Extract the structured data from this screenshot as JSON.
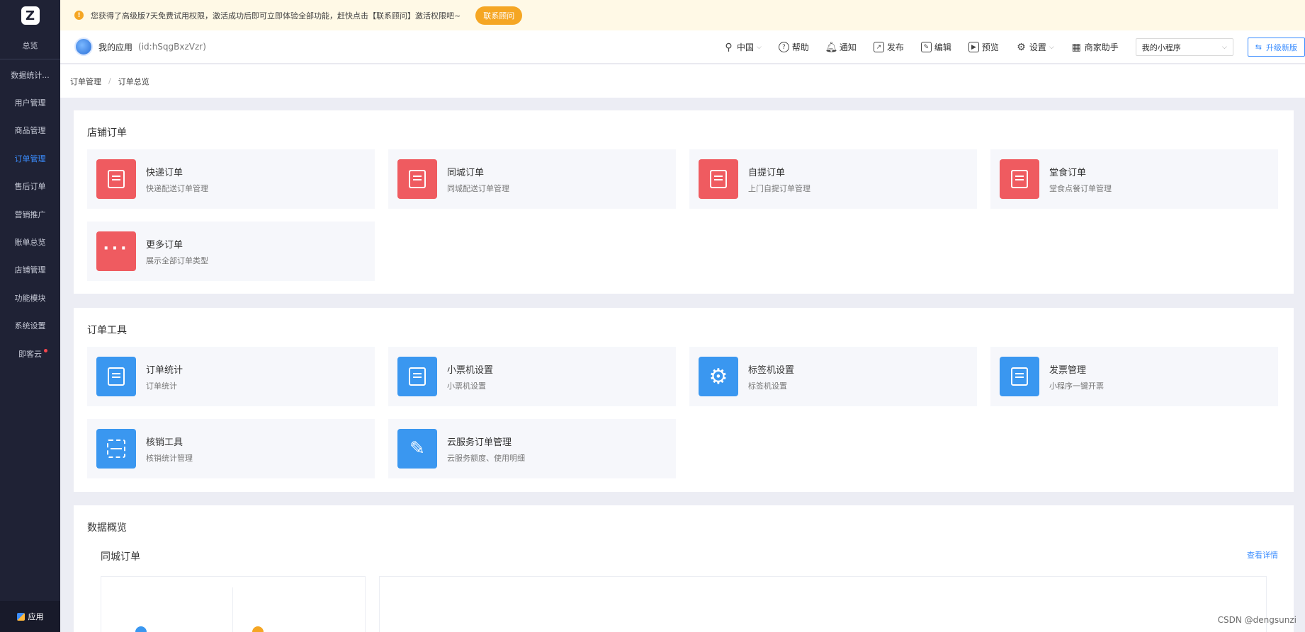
{
  "sidebar": {
    "logo": "Z",
    "items": [
      {
        "label": "总览"
      },
      {
        "label": "数据统计..."
      },
      {
        "label": "用户管理"
      },
      {
        "label": "商品管理"
      },
      {
        "label": "订单管理"
      },
      {
        "label": "售后订单"
      },
      {
        "label": "营销推广"
      },
      {
        "label": "账单总览"
      },
      {
        "label": "店铺管理"
      },
      {
        "label": "功能模块"
      },
      {
        "label": "系统设置"
      },
      {
        "label": "即客云"
      }
    ],
    "active_index": 4,
    "bottom_label": "应用"
  },
  "banner": {
    "text": "您获得了高级版7天免费试用权限，激活成功后即可立即体验全部功能，赶快点击【联系顾问】激活权限吧~",
    "button": "联系顾问"
  },
  "header": {
    "app_name": "我的应用",
    "app_id": "(id:hSqgBxzVzr)",
    "region": "中国",
    "help": "帮助",
    "notify": "通知",
    "publish": "发布",
    "edit": "编辑",
    "preview": "预览",
    "settings": "设置",
    "merchant": "商家助手",
    "select_value": "我的小程序",
    "upgrade": "升级新版"
  },
  "breadcrumb": {
    "items": [
      "订单管理",
      "订单总览"
    ]
  },
  "store_orders": {
    "title": "店铺订单",
    "tiles": [
      {
        "name": "快递订单",
        "desc": "快递配送订单管理"
      },
      {
        "name": "同城订单",
        "desc": "同城配送订单管理"
      },
      {
        "name": "自提订单",
        "desc": "上门自提订单管理"
      },
      {
        "name": "堂食订单",
        "desc": "堂食点餐订单管理"
      },
      {
        "name": "更多订单",
        "desc": "展示全部订单类型"
      }
    ]
  },
  "order_tools": {
    "title": "订单工具",
    "tiles": [
      {
        "name": "订单统计",
        "desc": "订单统计"
      },
      {
        "name": "小票机设置",
        "desc": "小票机设置"
      },
      {
        "name": "标签机设置",
        "desc": "标签机设置"
      },
      {
        "name": "发票管理",
        "desc": "小程序一键开票"
      },
      {
        "name": "核销工具",
        "desc": "核销统计管理"
      },
      {
        "name": "云服务订单管理",
        "desc": "云服务额度、使用明细"
      }
    ]
  },
  "overview": {
    "title": "数据概览",
    "subtitle": "同城订单",
    "detail_link": "查看详情"
  },
  "watermark": "CSDN @dengsunzi",
  "colors": {
    "sidebar_bg": "#1f2235",
    "accent": "#3b8dff",
    "tile_red": "#ef5b60",
    "tile_blue": "#3a97f0",
    "banner_bg": "#fff9e6",
    "banner_button": "#f5a623"
  }
}
